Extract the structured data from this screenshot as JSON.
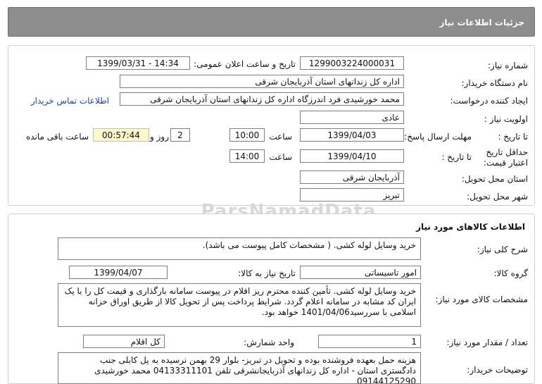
{
  "header": {
    "title": "جزئیات اطلاعات نیاز"
  },
  "need_info": {
    "need_number_label": "شماره نیاز:",
    "need_number": "1299003224000031",
    "announce_label": "تاریخ و ساعت اعلان عمومی:",
    "announce_value": "1399/03/31 - 14:34",
    "buyer_label": "نام دستگاه خریدار:",
    "buyer_value": "اداره کل زندانهای استان آذربایجان شرقی",
    "requester_label": "ایجاد کننده درخواست:",
    "requester_value": "محمد خورشیدی فرد اندرزگاه اداره کل زندانهای استان آذربایجان شرقی",
    "contact_link": "اطلاعات تماس خریدار",
    "priority_label": "اولویت نیاز :",
    "priority_value": "عادی",
    "deadline_label": "مهلت ارسال پاسخ:",
    "until_date_label": "تا تاریخ :",
    "deadline_date": "1399/04/03",
    "time_label": "ساعت",
    "deadline_time": "10:00",
    "days_value": "2",
    "days_label": "روز و",
    "remaining_time": "00:57:44",
    "remaining_label": "ساعت باقی مانده",
    "validity_label": "حداقل تاریخ اعتبار قیمت:",
    "validity_until_label": "تا تاریخ :",
    "validity_date": "1399/04/10",
    "validity_time_label": "ساعت",
    "validity_time": "14:00",
    "province_label": "استان محل تحویل:",
    "province_value": "آذربایجان شرقی",
    "city_label": "شهر محل تحویل:",
    "city_value": "تبریز"
  },
  "goods": {
    "section_title": "اطلاعات کالاهای مورد نیاز",
    "summary_label": "شرح کلی نیاز:",
    "summary_value": "خرید وسایل لوله کشی. ( مشخصات کامل پیوست می باشد).",
    "group_label": "گروه کالا:",
    "group_value": "امور تاسیساتی",
    "need_date_label": "تاریخ نیاز به کالا:",
    "need_date_value": "1399/04/07",
    "spec_label": "مشخصات کالای مورد نیاز:",
    "spec_value": "خرید وسایل لوله کشی. تأمین کننده محترم ریز اقلام در پیوست سامانه بارگذاری و قیمت کل را با یک ایران کد مشابه در سامانه اعلام گردد. شرایط پرداخت پس از تحویل کالا از طریق اوراق خزانه اسلامی با سررسید1401/04/06 خواهد بود.",
    "qty_label": "تعداد / مقدار مورد نیاز:",
    "qty_value": "1",
    "unit_label": "واحد شمارش:",
    "unit_value": "کل اقلام",
    "buyer_notes_label": "توضیحات خریدار:",
    "buyer_notes_value": "هزینه حمل بعهده فروشنده بوده و تحویل در تبریز- بلوار 29 بهمن نرسیده به پل کابلی جنب دادگستری استان - اداره کل زندانهای آذربایجانشرقی تلفن 04133311101 محمد خورشیدی 09144125290"
  },
  "watermark": "ParsNamadData"
}
